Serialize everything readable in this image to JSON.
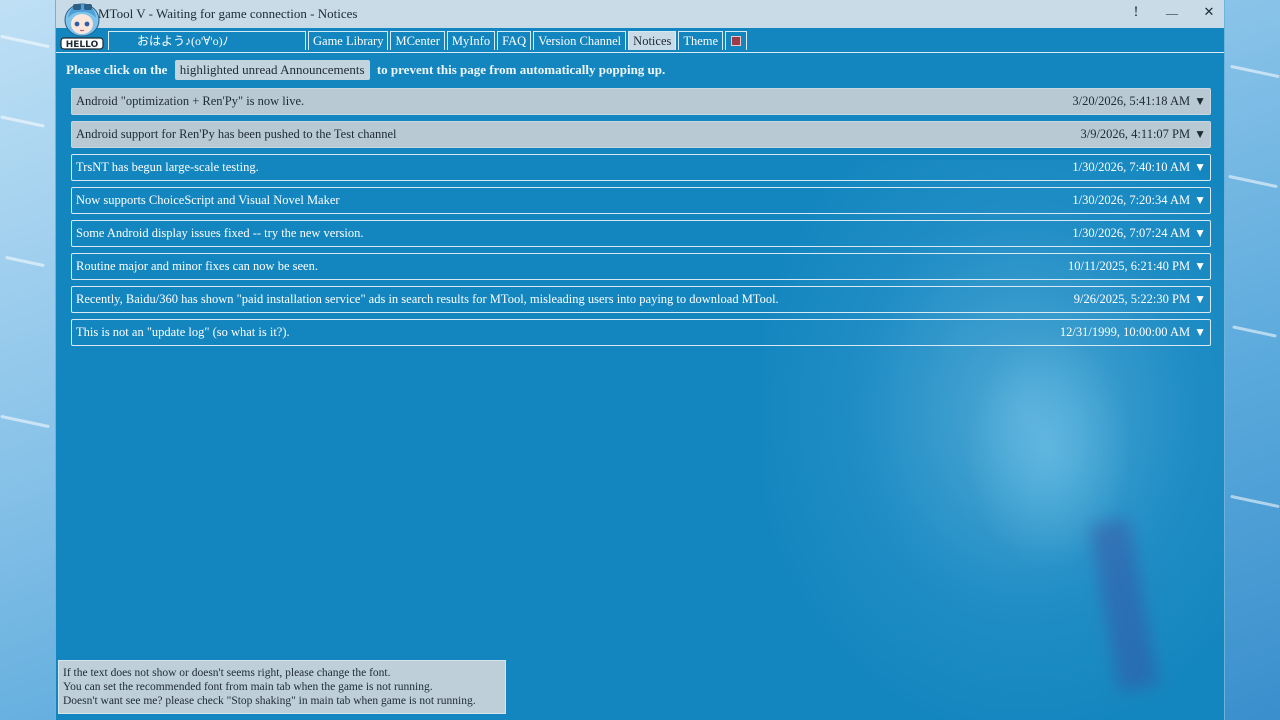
{
  "window": {
    "title": "MTool V - Waiting for game connection - Notices",
    "controls": {
      "alert": "!",
      "minimize": "—",
      "close": "✕"
    }
  },
  "avatar": {
    "badge": "HELLO"
  },
  "greeting": "おはよう♪(o'∀'o)ﾉ",
  "tabs": [
    {
      "label": "Game Library",
      "active": false
    },
    {
      "label": "MCenter",
      "active": false
    },
    {
      "label": "MyInfo",
      "active": false
    },
    {
      "label": "FAQ",
      "active": false
    },
    {
      "label": "Version Channel",
      "active": false
    },
    {
      "label": "Notices",
      "active": true
    },
    {
      "label": "Theme",
      "active": false
    }
  ],
  "tab_icon": "book-icon",
  "instruction": {
    "before": "Please click on the",
    "chip": "highlighted unread Announcements",
    "after": "to prevent this page from automatically popping up."
  },
  "notices": [
    {
      "title": "Android \"optimization + Ren'Py\" is now live.",
      "date": "3/20/2026, 5:41:18 AM",
      "unread": true
    },
    {
      "title": "Android support for Ren'Py has been pushed to the Test channel",
      "date": "3/9/2026, 4:11:07 PM",
      "unread": true
    },
    {
      "title": "TrsNT has begun large-scale testing.",
      "date": "1/30/2026, 7:40:10 AM",
      "unread": false
    },
    {
      "title": "Now supports ChoiceScript and Visual Novel Maker",
      "date": "1/30/2026, 7:20:34 AM",
      "unread": false
    },
    {
      "title": "Some Android display issues fixed -- try the new version.",
      "date": "1/30/2026, 7:07:24 AM",
      "unread": false
    },
    {
      "title": "Routine major and minor fixes can now be seen.",
      "date": "10/11/2025, 6:21:40 PM",
      "unread": false
    },
    {
      "title": "Recently, Baidu/360 has shown \"paid installation service\" ads in search results for MTool, misleading users into paying to download MTool.",
      "date": "9/26/2025, 5:22:30 PM",
      "unread": false
    },
    {
      "title": "This is not an \"update log\" (so what is it?).",
      "date": "12/31/1999, 10:00:00 AM",
      "unread": false
    }
  ],
  "expand_glyph": "▼",
  "font_note": {
    "line1": "If the text does not show or doesn't seems right, please change the font.",
    "line2": "You can set the recommended font from main tab when the game is not running.",
    "line3": "Doesn't want see me? please check \"Stop shaking\" in main tab when game is not running."
  },
  "colors": {
    "window_bg": "#1486bf",
    "titlebar_bg": "#c8dbe6",
    "unread_bg": "#b9c9d4"
  }
}
